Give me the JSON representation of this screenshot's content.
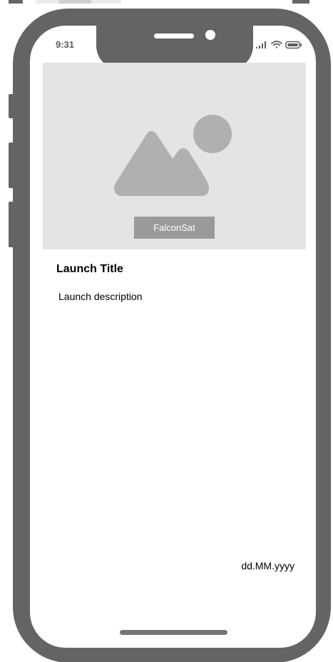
{
  "status_bar": {
    "time": "9:31",
    "signal_icon": "cellular-signal-icon",
    "wifi_icon": "wifi-icon",
    "battery_icon": "battery-icon"
  },
  "hero": {
    "image_icon": "image-placeholder-icon",
    "badge_label": "FalconSat"
  },
  "content": {
    "title": "Launch Title",
    "description": "Launch description",
    "date": "dd.MM.yyyy"
  },
  "colors": {
    "device_frame": "#646464",
    "image_background": "#e4e4e4",
    "image_shapes": "#b0b0b0",
    "badge_background": "#9a9a9a",
    "text": "#000000"
  }
}
